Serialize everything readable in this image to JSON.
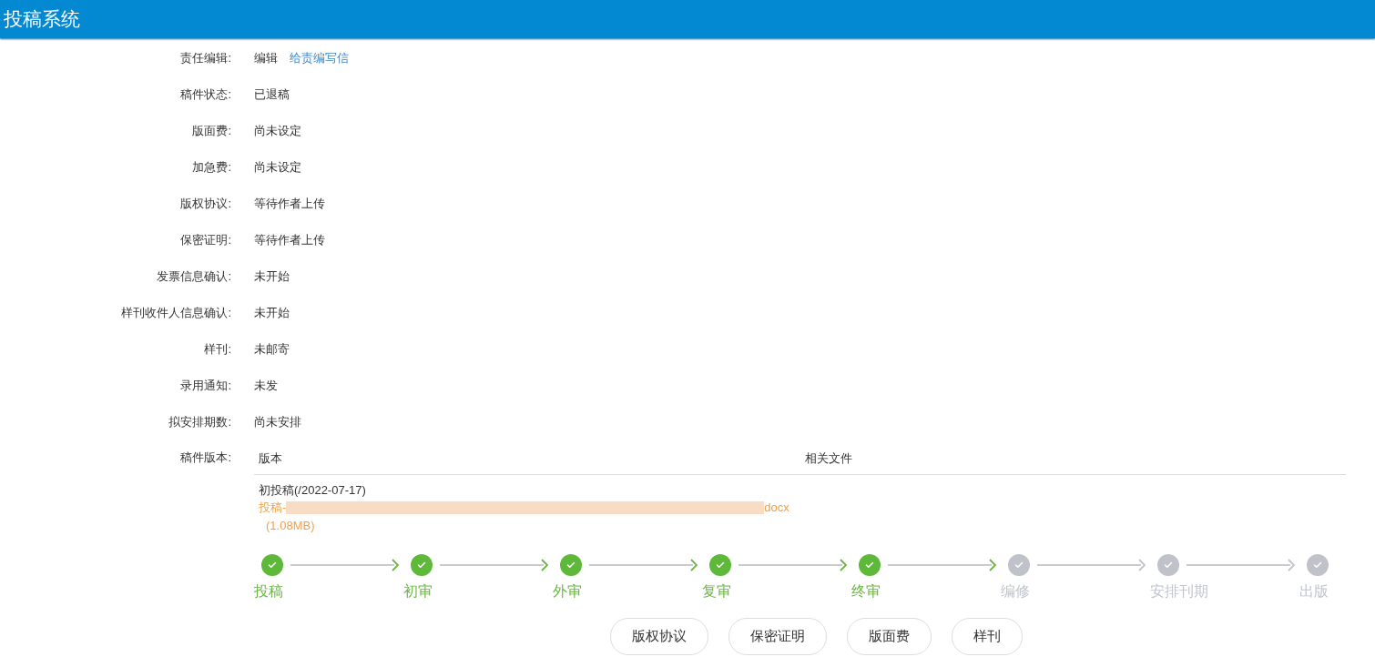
{
  "header": {
    "title": "投稿系统"
  },
  "fields": [
    {
      "label": "责任编辑:",
      "value": "编辑",
      "link": "给责编写信"
    },
    {
      "label": "稿件状态:",
      "value": "已退稿"
    },
    {
      "label": "版面费:",
      "value": "尚未设定"
    },
    {
      "label": "加急费:",
      "value": "尚未设定"
    },
    {
      "label": "版权协议:",
      "value": "等待作者上传"
    },
    {
      "label": "保密证明:",
      "value": "等待作者上传"
    },
    {
      "label": "发票信息确认:",
      "value": "未开始"
    },
    {
      "label": "样刊收件人信息确认:",
      "value": "未开始"
    },
    {
      "label": "样刊:",
      "value": "未邮寄"
    },
    {
      "label": "录用通知:",
      "value": "未发"
    },
    {
      "label": "拟安排期数:",
      "value": "尚未安排"
    }
  ],
  "versions": {
    "label": "稿件版本:",
    "columns": [
      "版本",
      "相关文件"
    ],
    "rows": [
      {
        "version": "初投稿(/2022-07-17)",
        "file_start": "投稿-",
        "file_end": "docx",
        "size": "(1.08MB)"
      }
    ]
  },
  "steps": [
    {
      "label": "投稿",
      "done": true
    },
    {
      "label": "初审",
      "done": true
    },
    {
      "label": "外审",
      "done": true
    },
    {
      "label": "复审",
      "done": true
    },
    {
      "label": "终审",
      "done": true
    },
    {
      "label": "编修",
      "done": false
    },
    {
      "label": "安排刊期",
      "done": false
    },
    {
      "label": "出版",
      "done": false
    }
  ],
  "buttons": [
    "版权协议",
    "保密证明",
    "版面费",
    "样刊"
  ]
}
